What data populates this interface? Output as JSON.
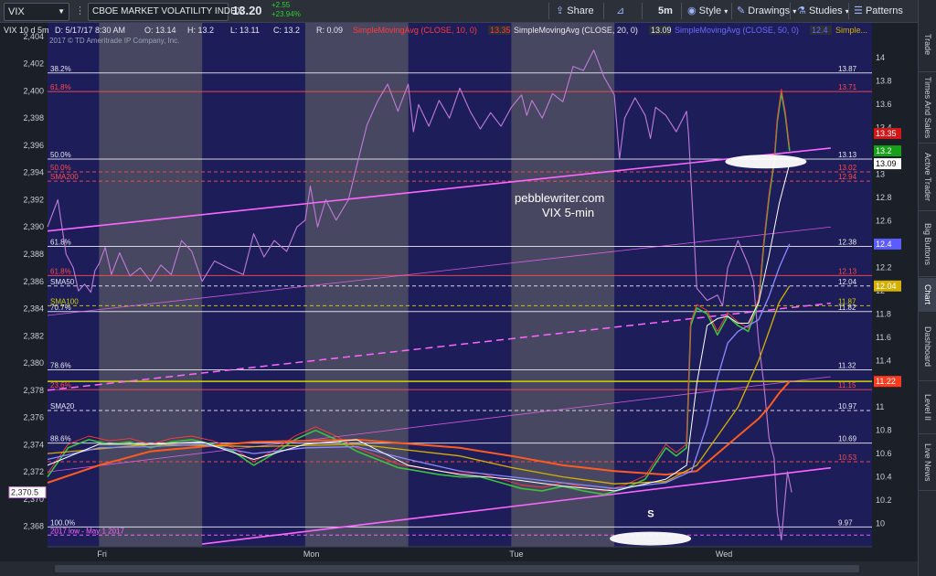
{
  "toolbar": {
    "symbol": "VIX",
    "company": "CBOE MARKET VOLATILITY INDEX",
    "price": "13.20",
    "change_pts": "+2.55",
    "change_pct": "+23.94%",
    "share": "Share",
    "interval": "5m",
    "style": "Style",
    "drawings": "Drawings",
    "studies": "Studies",
    "patterns": "Patterns"
  },
  "sidebar": {
    "tabs": [
      "Trade",
      "Times And Sales",
      "Active Trader",
      "Big Buttons",
      "Chart",
      "Dashboard",
      "Level II",
      "Live News"
    ],
    "active": "Chart"
  },
  "colors": {
    "background": "#1b1f27",
    "night_band": "#1d1d5a",
    "session_band": "#555566",
    "price": "#c07bd8",
    "vix": "#ff3b3b",
    "sma10": "#ffffff",
    "sma20": "#8b8bff",
    "sma50": "#d4b000",
    "sma100": "#ff5a1f",
    "fib": "#ffffff",
    "fib_red": "#ff4b4b",
    "trend": "#ff66ff",
    "yellow_line": "#d4d400"
  },
  "chart_data": {
    "type": "line",
    "header_line": "VIX 10 d 5m",
    "date_label": "5/17/17 8:30 AM",
    "ohlc": {
      "O": "13.14",
      "H": "13.2",
      "L": "13.11",
      "C": "13.2",
      "R": "0.09"
    },
    "studies": [
      {
        "label": "SimpleMovingAvg (CLOSE, 10, 0)",
        "value": "13.35"
      },
      {
        "label": "SimpleMovingAvg (CLOSE, 20, 0)",
        "value": "13.09"
      },
      {
        "label": "SimpleMovingAvg (CLOSE, 50, 0)",
        "value": "12.4"
      },
      {
        "label": "Simple..."
      }
    ],
    "copyright": "2017 © TD Ameritrade IP Company, Inc.",
    "watermark": [
      "pebblewriter.com",
      "VIX 5-min"
    ],
    "left_axis": {
      "ylim": [
        2366.5,
        2405
      ],
      "ticks": [
        2404,
        2402,
        2400,
        2398,
        2396,
        2394,
        2392,
        2390,
        2388,
        2386,
        2384,
        2382,
        2380,
        2378,
        2376,
        2374,
        2372,
        2370,
        2368
      ]
    },
    "right_axis": {
      "ylim": [
        9.8,
        14.3
      ],
      "ticks": [
        "14",
        "13.8",
        "13.6",
        "13.4",
        "13.2",
        "13",
        "12.8",
        "12.6",
        "12.4",
        "12.2",
        "12",
        "11.8",
        "11.6",
        "11.4",
        "11.2",
        "11",
        "10.8",
        "10.6",
        "10.4",
        "10.2",
        "10"
      ]
    },
    "x_labels": [
      "Fri",
      "Mon",
      "Tue",
      "Wed"
    ],
    "x_label_positions": [
      0.5,
      2.5,
      4.5,
      6.5
    ],
    "session_bands": [
      0.5,
      2.5,
      4.5
    ],
    "price_tag": "2,370.5",
    "fib_levels": [
      {
        "left": "38.2%",
        "right": "13.87",
        "y": 13.87,
        "color": "white"
      },
      {
        "left": "61.8%",
        "right": "13.71",
        "y": 13.71,
        "color": "red"
      },
      {
        "left": "50.0%",
        "right": "13.13",
        "y": 13.13,
        "color": "white"
      },
      {
        "left": "50.0%",
        "right": "13.02",
        "y": 13.02,
        "color": "red",
        "dashed": true
      },
      {
        "left": "SMA200",
        "right": "12.94",
        "y": 12.94,
        "color": "red",
        "dashed": true
      },
      {
        "left": "61.8%",
        "right": "12.38",
        "y": 12.38,
        "color": "white"
      },
      {
        "left": "61.8%",
        "right": "12.13",
        "y": 12.13,
        "color": "red"
      },
      {
        "left": "SMA50",
        "right": "12.04",
        "y": 12.04,
        "color": "white",
        "dashed": true
      },
      {
        "left": "SMA100",
        "right": "11.87",
        "y": 11.87,
        "color": "yellow",
        "dashed": true
      },
      {
        "left": "70.7%",
        "right": "11.82",
        "y": 11.82,
        "color": "white"
      },
      {
        "left": "78.6%",
        "right": "11.32",
        "y": 11.32,
        "color": "white"
      },
      {
        "left": "23.6%",
        "right": "11.15",
        "y": 11.15,
        "color": "red"
      },
      {
        "left": "SMA20",
        "right": "10.97",
        "y": 10.97,
        "color": "white",
        "dashed": true
      },
      {
        "left": "88.6%",
        "right": "10.69",
        "y": 10.69,
        "color": "white"
      },
      {
        "left": "",
        "right": "10.53",
        "y": 10.53,
        "color": "red",
        "dashed": true
      },
      {
        "left": "100.0%",
        "right": "9.97",
        "y": 9.97,
        "color": "white"
      },
      {
        "left": "2017 low - May 1 2017",
        "right": "",
        "y": 9.9,
        "color": "pink",
        "dashed": true
      }
    ],
    "yellow_level": 11.22,
    "right_tags": [
      {
        "text": "13.35",
        "y": 13.35,
        "color": "#d01818"
      },
      {
        "text": "13.2",
        "y": 13.2,
        "color": "#18a018"
      },
      {
        "text": "13.09",
        "y": 13.09,
        "color": "#ffffff"
      },
      {
        "text": "12.4",
        "y": 12.4,
        "color": "#5b5bff"
      },
      {
        "text": "12.04",
        "y": 12.04,
        "color": "#d4b000"
      },
      {
        "text": "11.22",
        "y": 11.22,
        "color": "#ff3b1f"
      }
    ],
    "trendlines": [
      {
        "x": [
          0,
          7.6
        ],
        "y": [
          2389.7,
          2395.8
        ],
        "style": "solid"
      },
      {
        "x": [
          0,
          7.6
        ],
        "y": [
          2383.5,
          2390.0
        ],
        "style": "thin"
      },
      {
        "x": [
          0,
          7.6
        ],
        "y": [
          2378.0,
          2384.4
        ],
        "style": "dashed"
      },
      {
        "x": [
          0,
          7.6
        ],
        "y": [
          2372.0,
          2379.0
        ],
        "style": "thin"
      },
      {
        "x": [
          1.5,
          7.6
        ],
        "y": [
          2366.7,
          2372.3
        ],
        "style": "solid"
      }
    ],
    "spx": {
      "x": [
        0,
        0.1,
        0.18,
        0.25,
        0.3,
        0.36,
        0.42,
        0.46,
        0.5,
        0.56,
        0.62,
        0.7,
        0.8,
        0.9,
        1.0,
        1.1,
        1.2,
        1.3,
        1.4,
        1.5,
        1.62,
        1.75,
        1.9,
        2.0,
        2.1,
        2.2,
        2.32,
        2.42,
        2.5,
        2.55,
        2.62,
        2.7,
        2.8,
        2.92,
        3.0,
        3.1,
        3.2,
        3.3,
        3.4,
        3.5,
        3.55,
        3.6,
        3.7,
        3.8,
        3.9,
        4.0,
        4.1,
        4.2,
        4.3,
        4.4,
        4.5,
        4.6,
        4.65,
        4.7,
        4.8,
        4.9,
        5.0,
        5.1,
        5.2,
        5.3,
        5.4,
        5.5,
        5.55,
        5.6,
        5.7,
        5.8,
        5.85,
        5.9,
        6.0,
        6.1,
        6.2,
        6.22,
        6.3,
        6.4,
        6.5,
        6.55,
        6.6,
        6.7,
        6.8,
        6.85,
        6.9,
        6.95,
        7.0,
        7.05,
        7.08,
        7.12,
        7.18,
        7.22
      ],
      "y": [
        2390,
        2392,
        2388,
        2387,
        2385.3,
        2385.8,
        2385.2,
        2386.8,
        2387.3,
        2388.5,
        2386.5,
        2388.1,
        2386.4,
        2387.0,
        2386.0,
        2387.2,
        2386.5,
        2389.0,
        2388.2,
        2386.0,
        2387.5,
        2387.0,
        2386.5,
        2389.5,
        2387.8,
        2389.0,
        2388.2,
        2390.0,
        2390.5,
        2393.0,
        2390.0,
        2392.0,
        2390.5,
        2392.0,
        2394.5,
        2397.5,
        2399.2,
        2400.5,
        2398.5,
        2400.5,
        2397.0,
        2399.0,
        2397.4,
        2399.3,
        2398.0,
        2400.2,
        2398.5,
        2397.2,
        2398.4,
        2397.4,
        2398.8,
        2399.7,
        2398.2,
        2399.3,
        2398.0,
        2399.8,
        2399.2,
        2401.8,
        2401.5,
        2403.0,
        2401.0,
        2399.7,
        2395.0,
        2398.0,
        2399.5,
        2398.2,
        2396.5,
        2398.8,
        2398.2,
        2397.0,
        2398.5,
        2396.8,
        2385.5,
        2384.6,
        2385.0,
        2384.2,
        2387.0,
        2389.0,
        2387.2,
        2386.0,
        2381.5,
        2378.5,
        2374.5,
        2373.0,
        2369.0,
        2367.0,
        2372.0,
        2370.5
      ]
    },
    "vix": {
      "x": [
        0,
        0.2,
        0.4,
        0.6,
        0.8,
        1.0,
        1.2,
        1.4,
        1.6,
        1.8,
        2.0,
        2.2,
        2.4,
        2.6,
        2.8,
        3.0,
        3.2,
        3.4,
        3.6,
        3.8,
        4.0,
        4.2,
        4.4,
        4.6,
        4.8,
        5.0,
        5.2,
        5.4,
        5.6,
        5.8,
        6.0,
        6.1,
        6.2,
        6.24,
        6.3,
        6.4,
        6.5,
        6.6,
        6.7,
        6.8,
        6.9,
        6.95,
        7.0,
        7.05,
        7.08,
        7.12,
        7.16,
        7.2
      ],
      "y": [
        10.4,
        10.65,
        10.72,
        10.68,
        10.7,
        10.65,
        10.7,
        10.72,
        10.68,
        10.62,
        10.5,
        10.6,
        10.72,
        10.8,
        10.72,
        10.62,
        10.55,
        10.48,
        10.45,
        10.42,
        10.4,
        10.4,
        10.35,
        10.3,
        10.28,
        10.32,
        10.28,
        10.25,
        10.3,
        10.38,
        10.65,
        10.58,
        10.65,
        11.7,
        11.85,
        11.8,
        11.62,
        11.78,
        11.7,
        11.65,
        11.9,
        12.4,
        12.8,
        13.1,
        13.45,
        13.7,
        13.5,
        13.2
      ]
    },
    "sma10": {
      "x": [
        0,
        0.5,
        1.0,
        1.5,
        2.0,
        2.5,
        3.0,
        3.5,
        4.0,
        4.5,
        5.0,
        5.5,
        6.0,
        6.2,
        6.3,
        6.4,
        6.5,
        6.6,
        6.7,
        6.8,
        6.9,
        7.0,
        7.1,
        7.2
      ],
      "y": [
        10.5,
        10.68,
        10.68,
        10.7,
        10.55,
        10.68,
        10.72,
        10.5,
        10.42,
        10.38,
        10.32,
        10.28,
        10.38,
        10.5,
        11.2,
        11.7,
        11.76,
        11.78,
        11.72,
        11.72,
        11.9,
        12.3,
        12.75,
        13.09
      ]
    },
    "sma20": {
      "x": [
        0,
        0.5,
        1.0,
        1.5,
        2.0,
        2.5,
        3.0,
        3.5,
        4.0,
        4.5,
        5.0,
        5.5,
        6.0,
        6.25,
        6.4,
        6.5,
        6.6,
        6.7,
        6.8,
        6.9,
        7.0,
        7.1,
        7.2
      ],
      "y": [
        10.55,
        10.65,
        10.66,
        10.68,
        10.6,
        10.65,
        10.66,
        10.55,
        10.45,
        10.4,
        10.35,
        10.3,
        10.35,
        10.45,
        10.85,
        11.25,
        11.55,
        11.65,
        11.7,
        11.75,
        11.95,
        12.2,
        12.4
      ]
    },
    "sma50": {
      "x": [
        0,
        1.0,
        2.0,
        3.0,
        4.0,
        4.5,
        5.0,
        5.5,
        6.0,
        6.3,
        6.5,
        6.7,
        6.9,
        7.0,
        7.1,
        7.2
      ],
      "y": [
        10.6,
        10.68,
        10.66,
        10.68,
        10.58,
        10.48,
        10.4,
        10.34,
        10.36,
        10.5,
        10.75,
        11.0,
        11.4,
        11.65,
        11.9,
        12.04
      ]
    },
    "sma100": {
      "x": [
        0,
        0.5,
        1.0,
        2.0,
        3.0,
        4.0,
        4.5,
        5.0,
        5.5,
        6.0,
        6.3,
        6.5,
        6.7,
        6.9,
        7.0,
        7.1,
        7.2
      ],
      "y": [
        10.35,
        10.5,
        10.62,
        10.7,
        10.72,
        10.65,
        10.58,
        10.5,
        10.45,
        10.42,
        10.45,
        10.6,
        10.75,
        10.9,
        11.0,
        11.12,
        11.22
      ]
    },
    "annotations": [
      {
        "type": "ellipse",
        "x": 6.97,
        "y": 2394.8
      },
      {
        "type": "ellipse",
        "x": 5.85,
        "y": 2367.1
      },
      {
        "type": "text",
        "text": "S",
        "x": 5.82,
        "y": 2368.7
      }
    ]
  }
}
